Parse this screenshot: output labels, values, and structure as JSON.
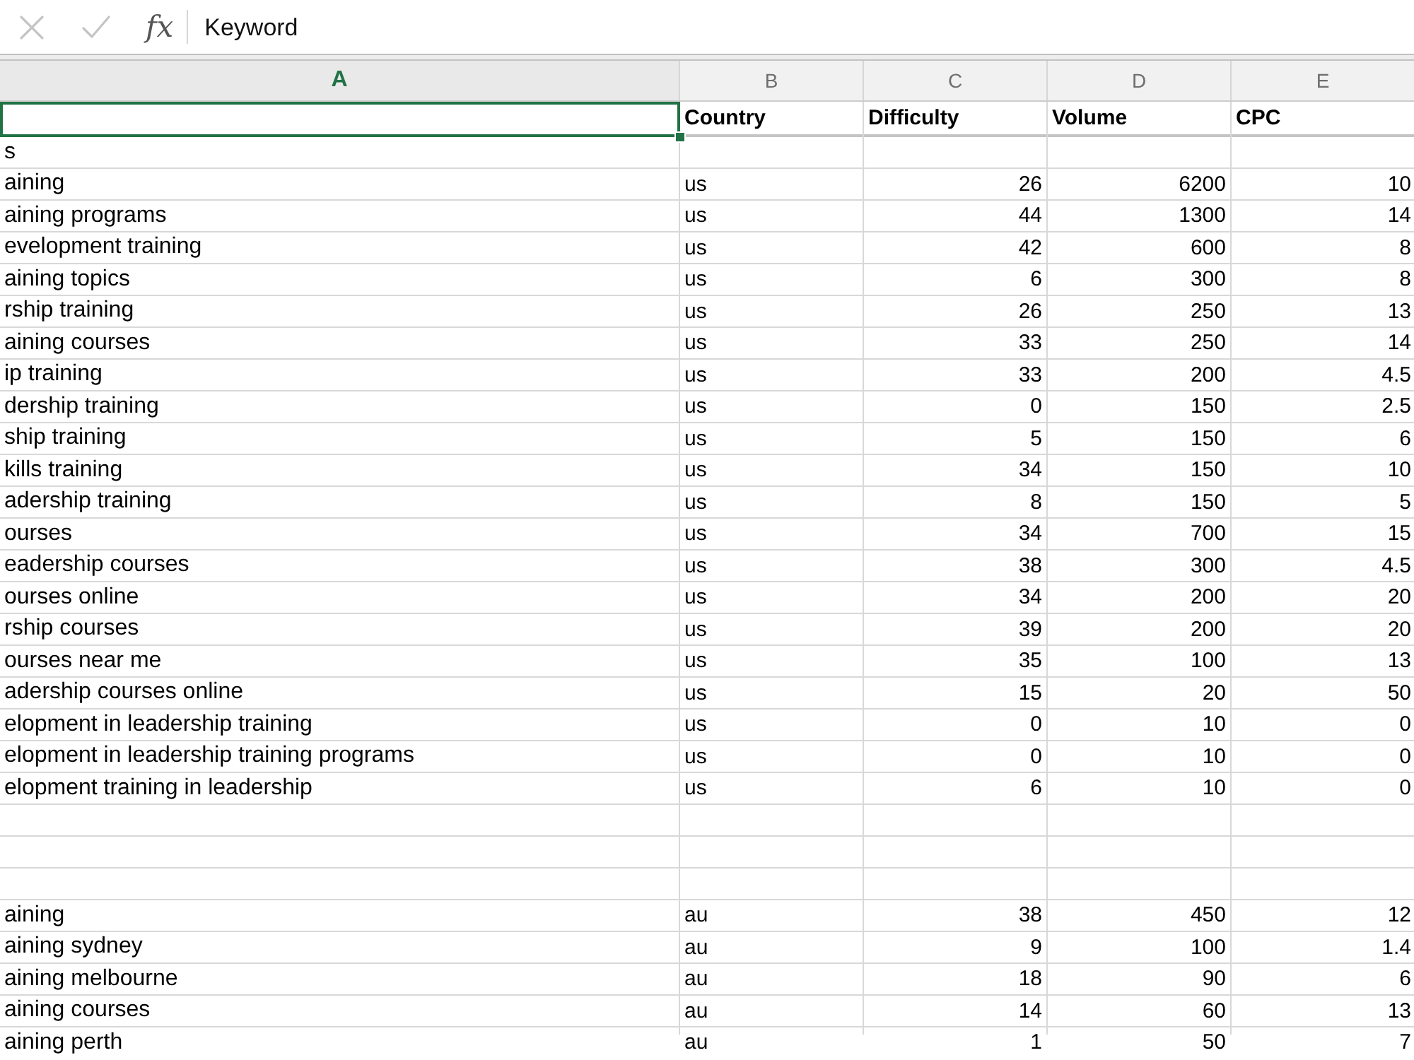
{
  "formula_bar": {
    "buttons": [
      {
        "kind": "cancel",
        "disabled": true
      },
      {
        "kind": "enter",
        "disabled": true
      }
    ],
    "function_symbol": "fx",
    "value": "Keyword"
  },
  "sheet": {
    "columns": [
      {
        "label": "A",
        "selected": true
      },
      {
        "label": "B",
        "selected": false
      },
      {
        "label": "C",
        "selected": false
      },
      {
        "label": "D",
        "selected": false
      },
      {
        "label": "E",
        "selected": false
      }
    ],
    "rows": [
      {
        "kind": "header",
        "column_a": {
          "selected": true
        },
        "cells": [
          "Country",
          "Difficulty",
          "Volume",
          "CPC"
        ]
      },
      {
        "kind": "data",
        "column_a": {
          "text": "s",
          "selected": false
        }
      },
      {
        "kind": "data",
        "column_a": {
          "text": "aining",
          "selected": false
        },
        "cells": [
          "us",
          "26",
          "6200",
          "10"
        ]
      },
      {
        "kind": "data",
        "column_a": {
          "text": "aining programs",
          "selected": false
        },
        "cells": [
          "us",
          "44",
          "1300",
          "14"
        ]
      },
      {
        "kind": "data",
        "column_a": {
          "text": "evelopment training",
          "selected": false
        },
        "cells": [
          "us",
          "42",
          "600",
          "8"
        ]
      },
      {
        "kind": "data",
        "column_a": {
          "text": "aining topics",
          "selected": false
        },
        "cells": [
          "us",
          "6",
          "300",
          "8"
        ]
      },
      {
        "kind": "data",
        "column_a": {
          "text": "rship training",
          "selected": false
        },
        "cells": [
          "us",
          "26",
          "250",
          "13"
        ]
      },
      {
        "kind": "data",
        "column_a": {
          "text": "aining courses",
          "selected": false
        },
        "cells": [
          "us",
          "33",
          "250",
          "14"
        ]
      },
      {
        "kind": "data",
        "column_a": {
          "text": "ip training",
          "selected": false
        },
        "cells": [
          "us",
          "33",
          "200",
          "4.5"
        ]
      },
      {
        "kind": "data",
        "column_a": {
          "text": "dership training",
          "selected": false
        },
        "cells": [
          "us",
          "0",
          "150",
          "2.5"
        ]
      },
      {
        "kind": "data",
        "column_a": {
          "text": "ship training",
          "selected": false
        },
        "cells": [
          "us",
          "5",
          "150",
          "6"
        ]
      },
      {
        "kind": "data",
        "column_a": {
          "text": "kills training",
          "selected": false
        },
        "cells": [
          "us",
          "34",
          "150",
          "10"
        ]
      },
      {
        "kind": "data",
        "column_a": {
          "text": "adership training",
          "selected": false
        },
        "cells": [
          "us",
          "8",
          "150",
          "5"
        ]
      },
      {
        "kind": "data",
        "column_a": {
          "text": "ourses",
          "selected": false
        },
        "cells": [
          "us",
          "34",
          "700",
          "15"
        ]
      },
      {
        "kind": "data",
        "column_a": {
          "text": "eadership courses",
          "selected": false
        },
        "cells": [
          "us",
          "38",
          "300",
          "4.5"
        ]
      },
      {
        "kind": "data",
        "column_a": {
          "text": "ourses online",
          "selected": false
        },
        "cells": [
          "us",
          "34",
          "200",
          "20"
        ]
      },
      {
        "kind": "data",
        "column_a": {
          "text": "rship courses",
          "selected": false
        },
        "cells": [
          "us",
          "39",
          "200",
          "20"
        ]
      },
      {
        "kind": "data",
        "column_a": {
          "text": "ourses near me",
          "selected": false
        },
        "cells": [
          "us",
          "35",
          "100",
          "13"
        ]
      },
      {
        "kind": "data",
        "column_a": {
          "text": "adership courses online",
          "selected": false
        },
        "cells": [
          "us",
          "15",
          "20",
          "50"
        ]
      },
      {
        "kind": "data",
        "column_a": {
          "text": "elopment in leadership training",
          "selected": false
        },
        "cells": [
          "us",
          "0",
          "10",
          "0"
        ]
      },
      {
        "kind": "data",
        "column_a": {
          "text": "elopment in leadership training programs",
          "selected": false
        },
        "cells": [
          "us",
          "0",
          "10",
          "0"
        ]
      },
      {
        "kind": "data",
        "column_a": {
          "text": "elopment training in leadership",
          "selected": false
        },
        "cells": [
          "us",
          "6",
          "10",
          "0"
        ]
      },
      {
        "kind": "data",
        "column_a": {
          "selected": false
        }
      },
      {
        "kind": "data",
        "column_a": {
          "selected": false
        }
      },
      {
        "kind": "data",
        "column_a": {
          "selected": false
        }
      },
      {
        "kind": "data",
        "column_a": {
          "text": "aining",
          "selected": false
        },
        "cells": [
          "au",
          "38",
          "450",
          "12"
        ]
      },
      {
        "kind": "data",
        "column_a": {
          "text": "aining sydney",
          "selected": false
        },
        "cells": [
          "au",
          "9",
          "100",
          "1.4"
        ]
      },
      {
        "kind": "data",
        "column_a": {
          "text": "aining melbourne",
          "selected": false
        },
        "cells": [
          "au",
          "18",
          "90",
          "6"
        ]
      },
      {
        "kind": "data",
        "column_a": {
          "text": "aining courses",
          "selected": false
        },
        "cells": [
          "au",
          "14",
          "60",
          "13"
        ]
      },
      {
        "kind": "data",
        "column_a": {
          "text": "aining perth",
          "selected": false
        },
        "cells": [
          "au",
          "1",
          "50",
          "7"
        ]
      }
    ]
  }
}
